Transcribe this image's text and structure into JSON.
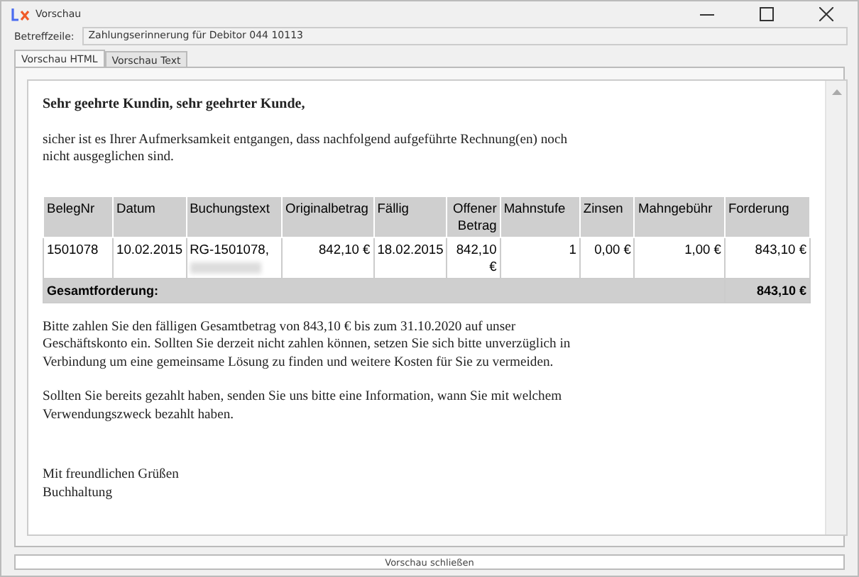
{
  "window": {
    "title": "Vorschau"
  },
  "subject": {
    "label": "Betreffzeile:",
    "value": "Zahlungserinnerung für Debitor 044 10113"
  },
  "tabs": [
    {
      "label": "Vorschau HTML",
      "selected": true
    },
    {
      "label": "Vorschau Text",
      "selected": false
    }
  ],
  "letter": {
    "greeting": "Sehr geehrte Kundin, sehr geehrter Kunde,",
    "intro": [
      "sicher ist es Ihrer Aufmerksamkeit entgangen, dass nachfolgend aufgeführte Rechnung(en) noch",
      "nicht ausgeglichen sind."
    ],
    "table": {
      "columns": [
        "BelegNr",
        "Datum",
        "Buchungstext",
        "Originalbetrag",
        "Fällig",
        "Offener Betrag",
        "Mahnstufe",
        "Zinsen",
        "Mahngebühr",
        "Forderung"
      ],
      "rows": [
        {
          "cells": [
            {
              "text": "1501078",
              "redacted": false
            },
            {
              "text": "10.02.2015",
              "redacted": false
            },
            {
              "text": "RG-1501078,",
              "redacted": true
            },
            {
              "text": "842,10 €",
              "redacted": false
            },
            {
              "text": "18.02.2015",
              "redacted": false
            },
            {
              "text": "842,10 €",
              "redacted": false
            },
            {
              "text": "1",
              "redacted": false
            },
            {
              "text": "0,00 €",
              "redacted": false
            },
            {
              "text": "1,00 €",
              "redacted": false
            },
            {
              "text": "843,10 €",
              "redacted": false
            }
          ]
        }
      ],
      "total": {
        "label": "Gesamtforderung:",
        "value": "843,10 €"
      }
    },
    "paragraphs": [
      [
        "Bitte zahlen Sie den fälligen Gesamtbetrag von 843,10 € bis zum 31.10.2020 auf unser",
        "Geschäftskonto ein. Sollten Sie derzeit nicht zahlen können, setzen Sie sich bitte unverzüglich in",
        "Verbindung um eine gemeinsame Lösung zu finden und weitere Kosten für Sie zu vermeiden."
      ],
      [
        "Sollten Sie bereits gezahlt haben, senden Sie uns bitte eine Information, wann Sie mit welchem",
        "Verwendungszweck bezahlt haben."
      ]
    ],
    "closing": [
      "Mit freundlichen Grüßen",
      "Buchhaltung"
    ]
  },
  "close_button": "Vorschau schließen"
}
